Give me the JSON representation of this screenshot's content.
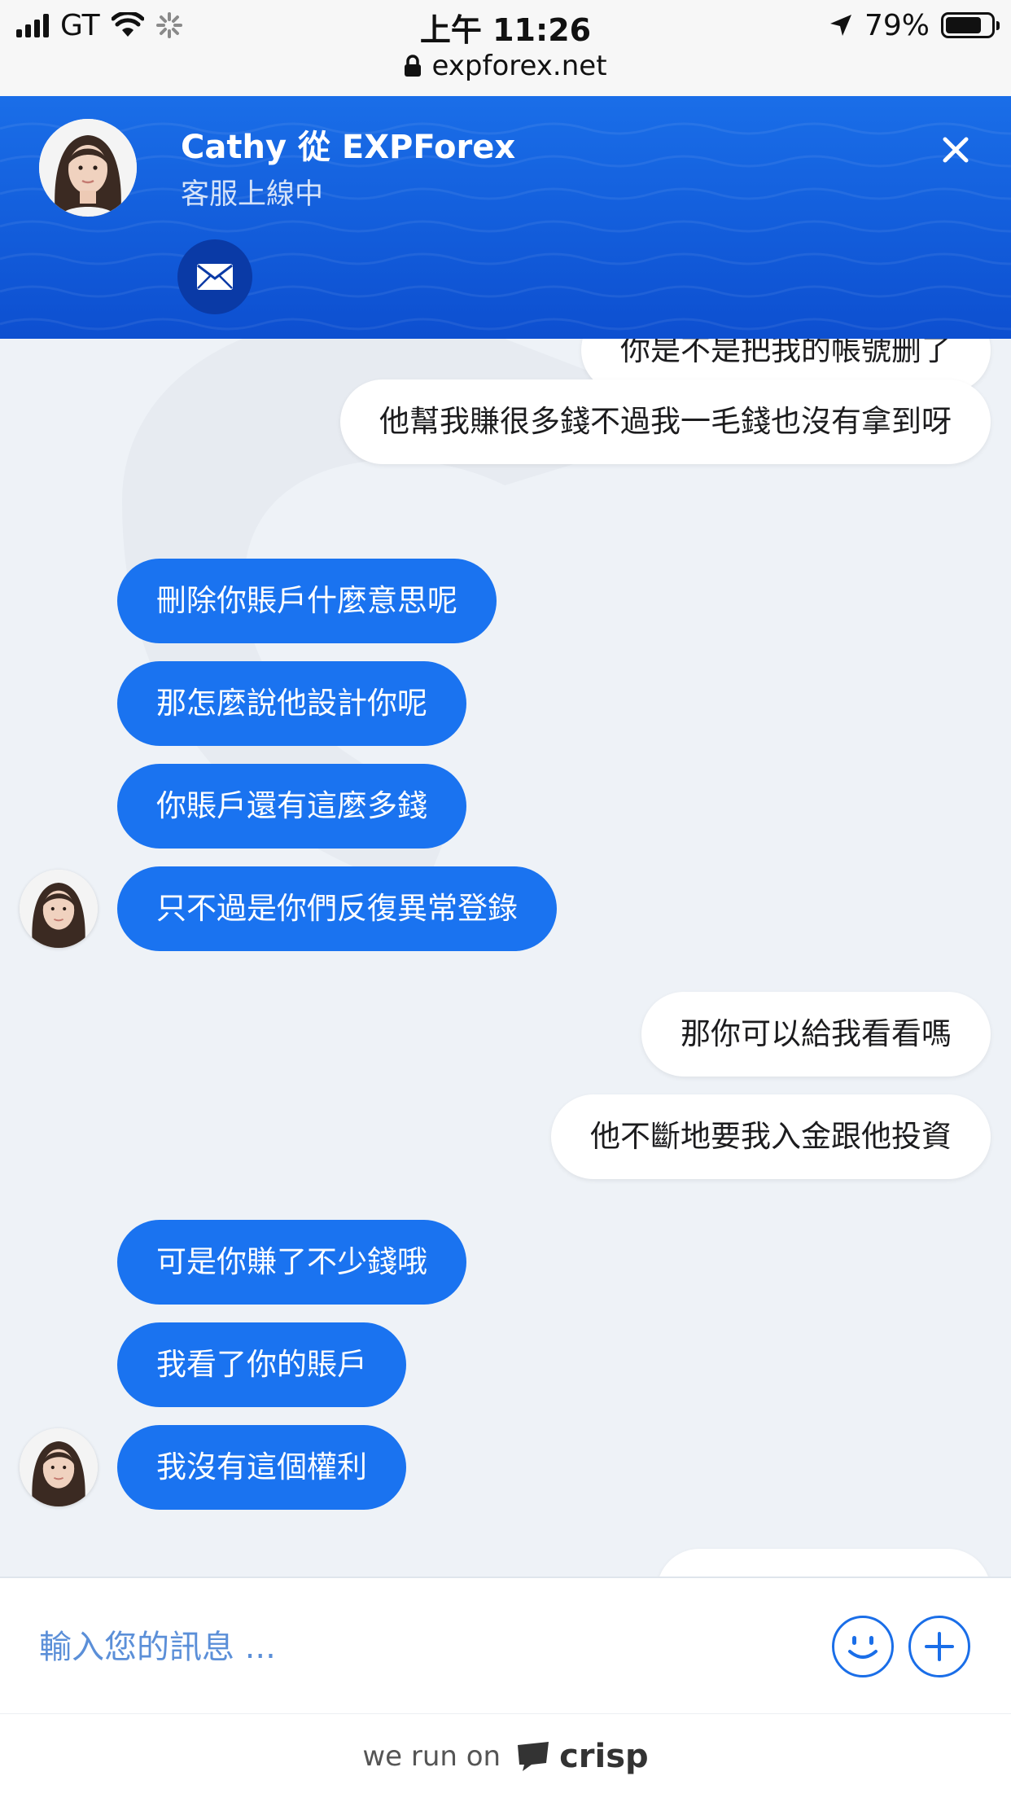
{
  "status_bar": {
    "carrier": "GT",
    "time": "上午 11:26",
    "battery": "79%",
    "battery_level": 0.79,
    "url": "expforex.net"
  },
  "header": {
    "agent_name": "Cathy 從 EXPForex",
    "agent_status": "客服上線中",
    "email_icon": "envelope-icon",
    "close_icon": "close-icon",
    "color": "#1a6ee8"
  },
  "messages": [
    {
      "from": "user",
      "text": "你是不是把我的帳號删了"
    },
    {
      "from": "user",
      "text": "他幫我賺很多錢不過我一毛錢也沒有拿到呀"
    },
    {
      "from": "agent",
      "text": "刪除你賬戶什麼意思呢"
    },
    {
      "from": "agent",
      "text": "那怎麼說他設計你呢"
    },
    {
      "from": "agent",
      "text": "你賬戶還有這麼多錢"
    },
    {
      "from": "agent",
      "text": "只不過是你們反復異常登錄"
    },
    {
      "from": "user",
      "text": "那你可以給我看看嗎"
    },
    {
      "from": "user",
      "text": "他不斷地要我入金跟他投資"
    },
    {
      "from": "agent",
      "text": "可是你賺了不少錢哦"
    },
    {
      "from": "agent",
      "text": "我看了你的賬戶"
    },
    {
      "from": "agent",
      "text": "我沒有這個權利"
    }
  ],
  "composer": {
    "placeholder": "輸入您的訊息 ...",
    "emoji_icon": "smiley-icon",
    "attach_icon": "plus-icon"
  },
  "footer": {
    "text": "we run on",
    "brand": "crisp"
  },
  "colors": {
    "accent": "#1a73f0",
    "background": "#eef2f7"
  }
}
